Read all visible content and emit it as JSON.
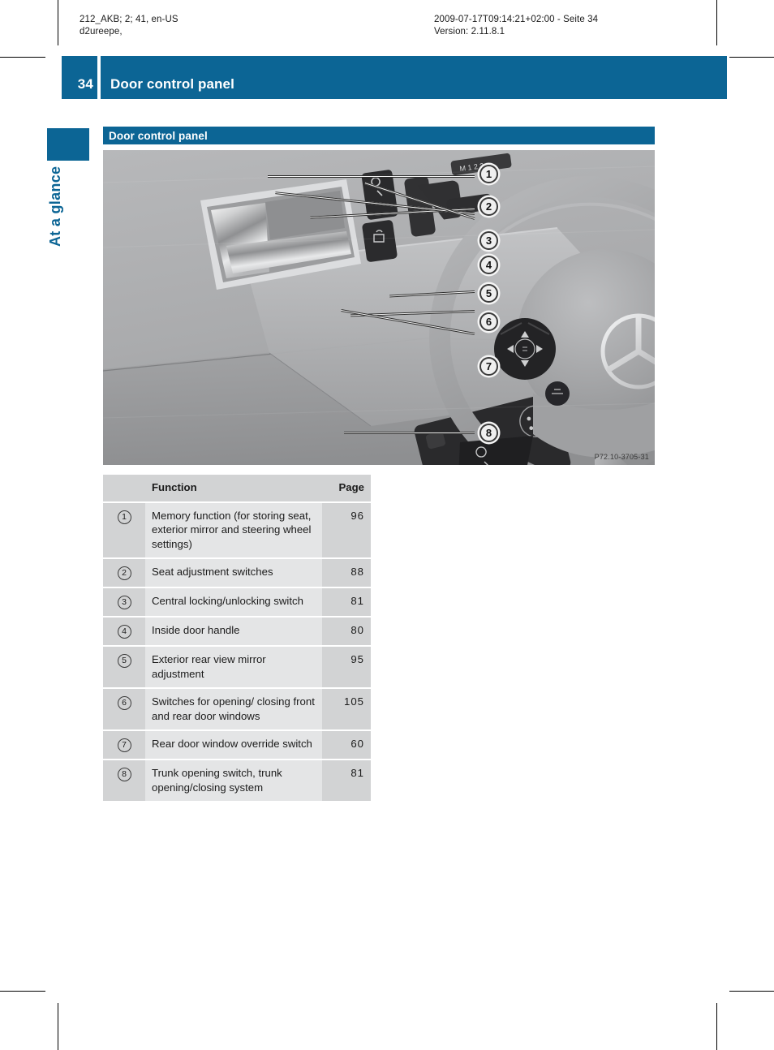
{
  "print_meta": {
    "left_line1": "212_AKB; 2; 41, en-US",
    "left_line2": "d2ureepe,",
    "right_line1": "2009-07-17T09:14:21+02:00 - Seite 34",
    "right_line2": "Version: 2.11.8.1"
  },
  "running_head": {
    "page_number": "34",
    "title": "Door control panel"
  },
  "chapter": {
    "label": "At a glance"
  },
  "section": {
    "heading": "Door control panel"
  },
  "figure": {
    "image_id": "P72.10-3705-31",
    "alt": "Driver door control panel with steering wheel",
    "callouts": [
      "1",
      "2",
      "3",
      "4",
      "5",
      "6",
      "7",
      "8"
    ]
  },
  "table": {
    "headers": {
      "num": "",
      "function": "Function",
      "page": "Page"
    },
    "rows": [
      {
        "num": "1",
        "function": "Memory function (for storing seat, exterior mirror and steering wheel settings)",
        "page": "96"
      },
      {
        "num": "2",
        "function": "Seat adjustment switches",
        "page": "88"
      },
      {
        "num": "3",
        "function": "Central locking/unlocking switch",
        "page": "81"
      },
      {
        "num": "4",
        "function": "Inside door handle",
        "page": "80"
      },
      {
        "num": "5",
        "function": "Exterior rear view mirror adjustment",
        "page": "95"
      },
      {
        "num": "6",
        "function": "Switches for opening/ closing front and rear door windows",
        "page": "105"
      },
      {
        "num": "7",
        "function": "Rear door window override switch",
        "page": "60"
      },
      {
        "num": "8",
        "function": "Trunk opening switch, trunk opening/closing system",
        "page": "81"
      }
    ]
  },
  "colors": {
    "brand_blue": "#0c6595",
    "table_dark": "#d2d3d4",
    "table_light": "#e4e5e6"
  }
}
